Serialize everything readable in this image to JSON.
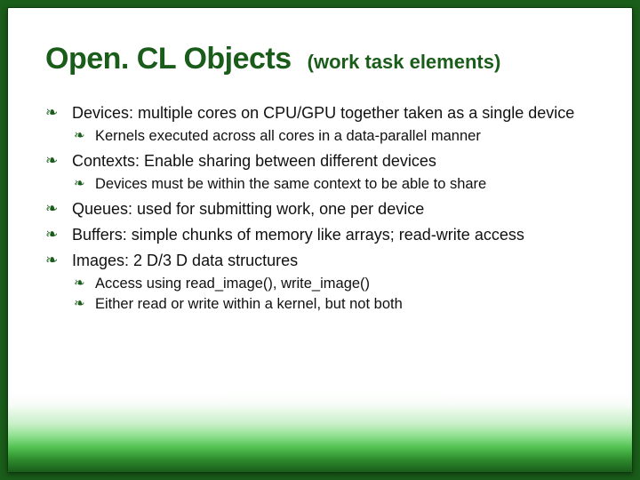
{
  "title": {
    "main": "Open. CL Objects",
    "sub": "(work task elements)"
  },
  "bullets": [
    {
      "text": "Devices: multiple cores on CPU/GPU together taken as a single device",
      "children": [
        {
          "text": "Kernels executed across all cores in a data-parallel manner"
        }
      ]
    },
    {
      "text": "Contexts: Enable sharing between different devices",
      "children": [
        {
          "text": "Devices must be within the same context to be able to share"
        }
      ]
    },
    {
      "text": "Queues: used for submitting work, one per device"
    },
    {
      "text": "Buffers: simple chunks of memory like arrays; read-write access"
    },
    {
      "text": "Images: 2 D/3 D data structures",
      "children": [
        {
          "text": "Access using read_image(), write_image()"
        },
        {
          "text": "Either read or write within a kernel, but not both"
        }
      ]
    }
  ]
}
